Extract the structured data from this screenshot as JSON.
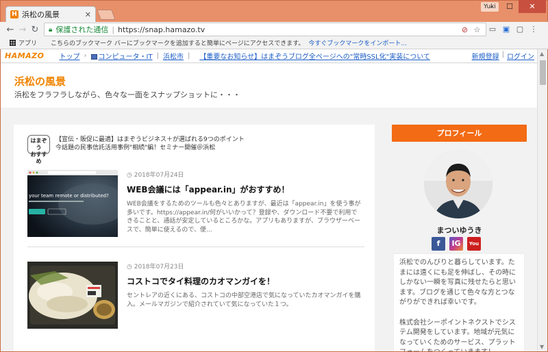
{
  "browser": {
    "tab_title": "浜松の風景",
    "user_label": "Yuki",
    "secure_label": "保護された通信",
    "url": "https://snap.hamazo.tv",
    "apps_label": "アプリ",
    "bookmarks_hint": "こちらのブックマーク バーにブックマークを追加すると簡単にページにアクセスできます。",
    "bookmarks_import": "今すぐブックマークをインポート..."
  },
  "hamazo_bar": {
    "logo": "HAMAZO",
    "crumbs": [
      "トップ",
      "コンピュータ・IT",
      "浜松市"
    ],
    "notice": "【重要なお知らせ】はまぞうブログ全ページへの\"常時SSL化\"実装について",
    "register": "新規登録",
    "login": "ログイン"
  },
  "blog": {
    "title": "浜松の風景",
    "description": "浜松をフラフラしながら、色々な一面をスナップショットに・・・"
  },
  "ad": {
    "badge": "はまぞう\nおすすめ",
    "line1": "【宣伝・販促に最適】はまぞうビジネス＋が選ばれる9つのポイント",
    "line2": "今話題の民事信託活用事例\"相続\"編！セミナー開催＠浜松"
  },
  "entries": [
    {
      "date": "2018年07月24日",
      "title": "WEB会議には「appear.in」がおすすめ！",
      "excerpt": "WEB会議をするためのツールも色々とありますが、最近は「appear.in」を使う事が多いです。https://appear.in/何がいいかって？登録や、ダウンロード不要で利用できることと、通話が安定しているところかな。アプリもありますが、ブラウザーベースで、簡単に使えるので、便...",
      "thumb_text": "your team remote or distributed?"
    },
    {
      "date": "2018年07月23日",
      "title": "コストコでタイ料理のカオマンガイを！",
      "excerpt": "セントレアの近くにある、コストコの中部空港店で気になっていたカオマンガイを購入。メールマガジンで紹介されていて気になっていた１つ。"
    }
  ],
  "sidebar": {
    "profile_button": "プロフィール",
    "name": "まついゆうき",
    "social": [
      "f",
      "IG",
      "You Tube"
    ],
    "bio": "浜松でのんびりと暮らしています。たまには遠くにも足を伸ばし、その時にしかない一瞬を写真に残せたらと思います。ブログを通じて色々な方とつながりができれば幸いです。\n\n株式会社シーポイントネクストでシステム開発をしています。地域が元気になっていくためのサービス、プラットフォームをつくっていきます！"
  },
  "colors": {
    "accent": "#f08300",
    "profile_button": "#f36b14",
    "frame": "#e8906a",
    "link": "#1a5cc7"
  }
}
